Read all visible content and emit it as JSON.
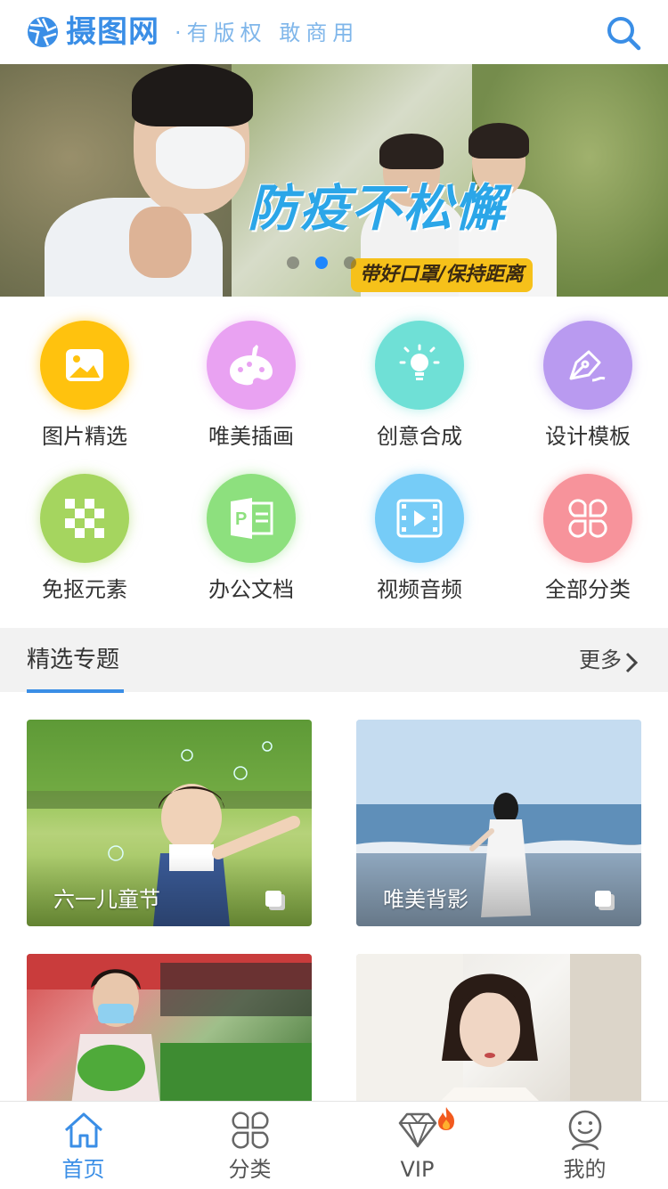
{
  "header": {
    "logo_text": "摄图网",
    "slogan": "·有版权 敢商用",
    "logo_icon": "camera-aperture-icon",
    "search_icon": "search-icon",
    "brand_color": "#3a8ee6"
  },
  "banner": {
    "title": "防疫不松懈",
    "subtitle": "带好口罩/保持距离",
    "slide_count": 3,
    "active_slide": 2
  },
  "categories": [
    {
      "label": "图片精选",
      "icon": "image-icon",
      "color": "#ffc20e"
    },
    {
      "label": "唯美插画",
      "icon": "palette-icon",
      "color": "#e9a2f2"
    },
    {
      "label": "创意合成",
      "icon": "lightbulb-icon",
      "color": "#6fe0d6"
    },
    {
      "label": "设计模板",
      "icon": "pen-nib-icon",
      "color": "#b99af0"
    },
    {
      "label": "免抠元素",
      "icon": "checkerboard-icon",
      "color": "#a5d55f"
    },
    {
      "label": "办公文档",
      "icon": "ppt-document-icon",
      "color": "#8de07e"
    },
    {
      "label": "视频音频",
      "icon": "film-icon",
      "color": "#76ccf7"
    },
    {
      "label": "全部分类",
      "icon": "grid-icon",
      "color": "#f7939b"
    }
  ],
  "section": {
    "title": "精选专题",
    "more": "更多"
  },
  "topics": [
    {
      "caption": "六一儿童节"
    },
    {
      "caption": "唯美背影"
    },
    {
      "caption": ""
    },
    {
      "caption": ""
    }
  ],
  "tabbar": [
    {
      "label": "首页",
      "icon": "home-icon",
      "active": true
    },
    {
      "label": "分类",
      "icon": "grid-icon",
      "active": false
    },
    {
      "label": "VIP",
      "icon": "diamond-icon",
      "active": false
    },
    {
      "label": "我的",
      "icon": "profile-icon",
      "active": false
    }
  ]
}
